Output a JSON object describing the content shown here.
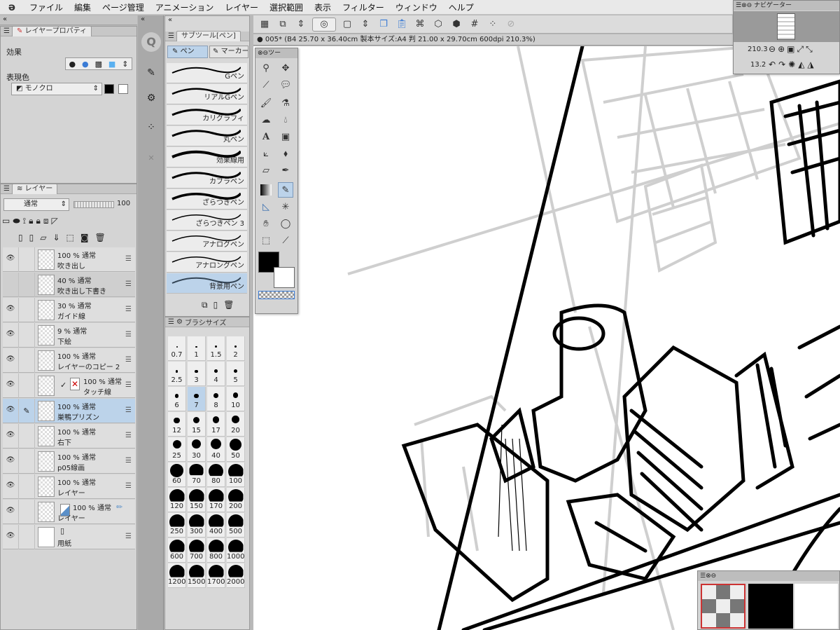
{
  "menu": {
    "logo": "ə",
    "items": [
      "ファイル",
      "編集",
      "ページ管理",
      "アニメーション",
      "レイヤー",
      "選択範囲",
      "表示",
      "フィルター",
      "ウィンドウ",
      "ヘルプ"
    ]
  },
  "document": {
    "title": "005* (B4 25.70 x 36.40cm 製本サイズ:A4 判 21.00 x 29.70cm 600dpi 210.3%)"
  },
  "property": {
    "tab": "レイヤープロパティ",
    "effect_label": "効果",
    "color_label": "表現色",
    "color_mode": "モノクロ"
  },
  "layers": {
    "tab": "レイヤー",
    "blend": "通常",
    "opacity": "100",
    "rows": [
      {
        "mode": "100 % 通常",
        "name": "吹き出し",
        "visible": true
      },
      {
        "mode": "40 % 通常",
        "name": "吹き出し下書き",
        "visible": false
      },
      {
        "mode": "30 % 通常",
        "name": "ガイド線",
        "visible": true
      },
      {
        "mode": "9 % 通常",
        "name": "下絵",
        "visible": true
      },
      {
        "mode": "100 % 通常",
        "name": "レイヤーのコピー 2",
        "visible": true
      },
      {
        "mode": "100 % 通常",
        "name": "タッチ線",
        "visible": true
      },
      {
        "mode": "100 % 通常",
        "name": "巣鴨プリズン",
        "visible": true
      },
      {
        "mode": "100 % 通常",
        "name": "右下",
        "visible": true
      },
      {
        "mode": "100 % 通常",
        "name": "p05線画",
        "visible": true
      },
      {
        "mode": "100 % 通常",
        "name": "レイヤー",
        "visible": true
      },
      {
        "mode": "100 % 通常",
        "name": "レイヤー",
        "visible": true
      },
      {
        "mode": "",
        "name": "用紙",
        "visible": true
      }
    ]
  },
  "subtool": {
    "title": "サブツール[ペン]",
    "tab_pen": "ペン",
    "tab_marker": "マーカー",
    "pens": [
      "Gペン",
      "リアルGペン",
      "カリグラフィ",
      "丸ペン",
      "効果線用",
      "カブラペン",
      "ざらつきペン",
      "ざらつきペン 3",
      "アナログペン",
      "アナロングペン",
      "背景用ペン"
    ]
  },
  "brushsize": {
    "title": "ブラシサイズ",
    "sizes": [
      "0.7",
      "1",
      "1.5",
      "2",
      "2.5",
      "3",
      "4",
      "5",
      "6",
      "7",
      "8",
      "10",
      "12",
      "15",
      "17",
      "20",
      "25",
      "30",
      "40",
      "50",
      "60",
      "70",
      "80",
      "100",
      "120",
      "150",
      "170",
      "200",
      "250",
      "300",
      "400",
      "500",
      "600",
      "700",
      "800",
      "1000",
      "1200",
      "1500",
      "1700",
      "2000"
    ],
    "selected": "7"
  },
  "toolpalette": {
    "title": "ツー"
  },
  "navigator": {
    "title": "ナビゲーター",
    "zoom": "210.3",
    "angle": "13.2"
  },
  "colors": {
    "accent": "#5a8fc8",
    "selected": "#bcd3ea",
    "canvas": "#ffffff"
  }
}
